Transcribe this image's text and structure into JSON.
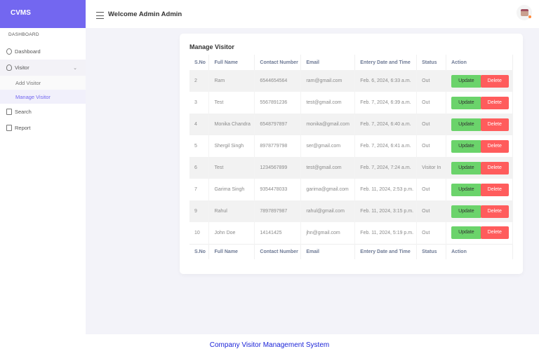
{
  "brand": "CVMS",
  "header": {
    "welcome": "Welcome Admin Admin"
  },
  "sidebar": {
    "section": "DASHBOARD",
    "dashboard": "Dashboard",
    "visitor": "Visitor",
    "add_visitor": "Add Visitor",
    "manage_visitor": "Manage Visitor",
    "search": "Search",
    "report": "Report"
  },
  "card": {
    "title": "Manage Visitor"
  },
  "table": {
    "headers": [
      "S.No",
      "Full Name",
      "Contact Number",
      "Email",
      "Entery Date and Time",
      "Status",
      "Action"
    ],
    "rows": [
      [
        "2",
        "Ram",
        "6544654564",
        "ram@gmail.com",
        "Feb. 6, 2024, 6:33 a.m.",
        "Out"
      ],
      [
        "3",
        "Test",
        "5567891236",
        "test@gmail.com",
        "Feb. 7, 2024, 6:39 a.m.",
        "Out"
      ],
      [
        "4",
        "Monika Chandra",
        "6548797897",
        "monika@gmail.com",
        "Feb. 7, 2024, 6:40 a.m.",
        "Out"
      ],
      [
        "5",
        "Shergil Singh",
        "8978779798",
        "ser@gmail.com",
        "Feb. 7, 2024, 6:41 a.m.",
        "Out"
      ],
      [
        "6",
        "Test",
        "1234567899",
        "test@gmail.com",
        "Feb. 7, 2024, 7:24 a.m.",
        "Visitor In"
      ],
      [
        "7",
        "Garima Singh",
        "9354478033",
        "garima@gmail.com",
        "Feb. 11, 2024, 2:53 p.m.",
        "Out"
      ],
      [
        "9",
        "Rahul",
        "7897897987",
        "rahul@gmail.com",
        "Feb. 11, 2024, 3:15 p.m.",
        "Out"
      ],
      [
        "10",
        "John Doe",
        "14141425",
        "jhn@gmail.com",
        "Feb. 11, 2024, 5:19 p.m.",
        "Out"
      ]
    ],
    "update_label": "Update",
    "delete_label": "Delete"
  },
  "footer": "Company Visitor Management System",
  "colors": {
    "brand": "#7367f0",
    "update": "#6bd36b",
    "delete": "#ff5c5c",
    "footer_text": "#1c24d8"
  }
}
